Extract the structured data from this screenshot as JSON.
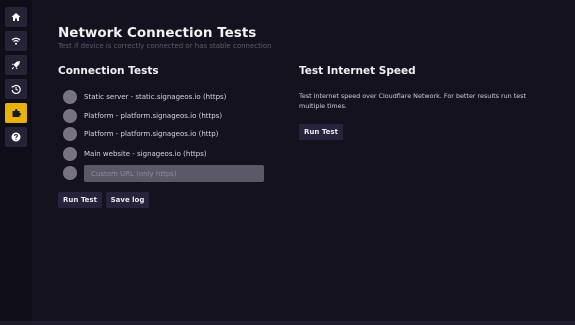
{
  "sidebar": {
    "items": [
      {
        "icon": "home-icon"
      },
      {
        "icon": "wifi-icon"
      },
      {
        "icon": "rocket-icon"
      },
      {
        "icon": "history-icon"
      },
      {
        "icon": "puzzle-icon",
        "active": true
      },
      {
        "icon": "help-icon"
      }
    ],
    "active_color": "#e8b20c"
  },
  "header": {
    "title": "Network Connection Tests",
    "subtitle": "Test if device is correctly connected or has stable connection"
  },
  "connection_tests": {
    "title": "Connection Tests",
    "items": [
      {
        "label": "Static server - static.signageos.io (https)"
      },
      {
        "label": "Platform - platform.signageos.io (https)"
      },
      {
        "label": "Platform - platform.signageos.io (http)"
      },
      {
        "label": "Main website - signageos.io (https)"
      }
    ],
    "custom_url_placeholder": "Custom URL (only https)",
    "run_button": "Run Test",
    "save_button": "Save log"
  },
  "internet_speed": {
    "title": "Test Internet Speed",
    "description": "Test internet speed over Cloudflare Network. For better results run test multiple times.",
    "run_button": "Run Test"
  }
}
